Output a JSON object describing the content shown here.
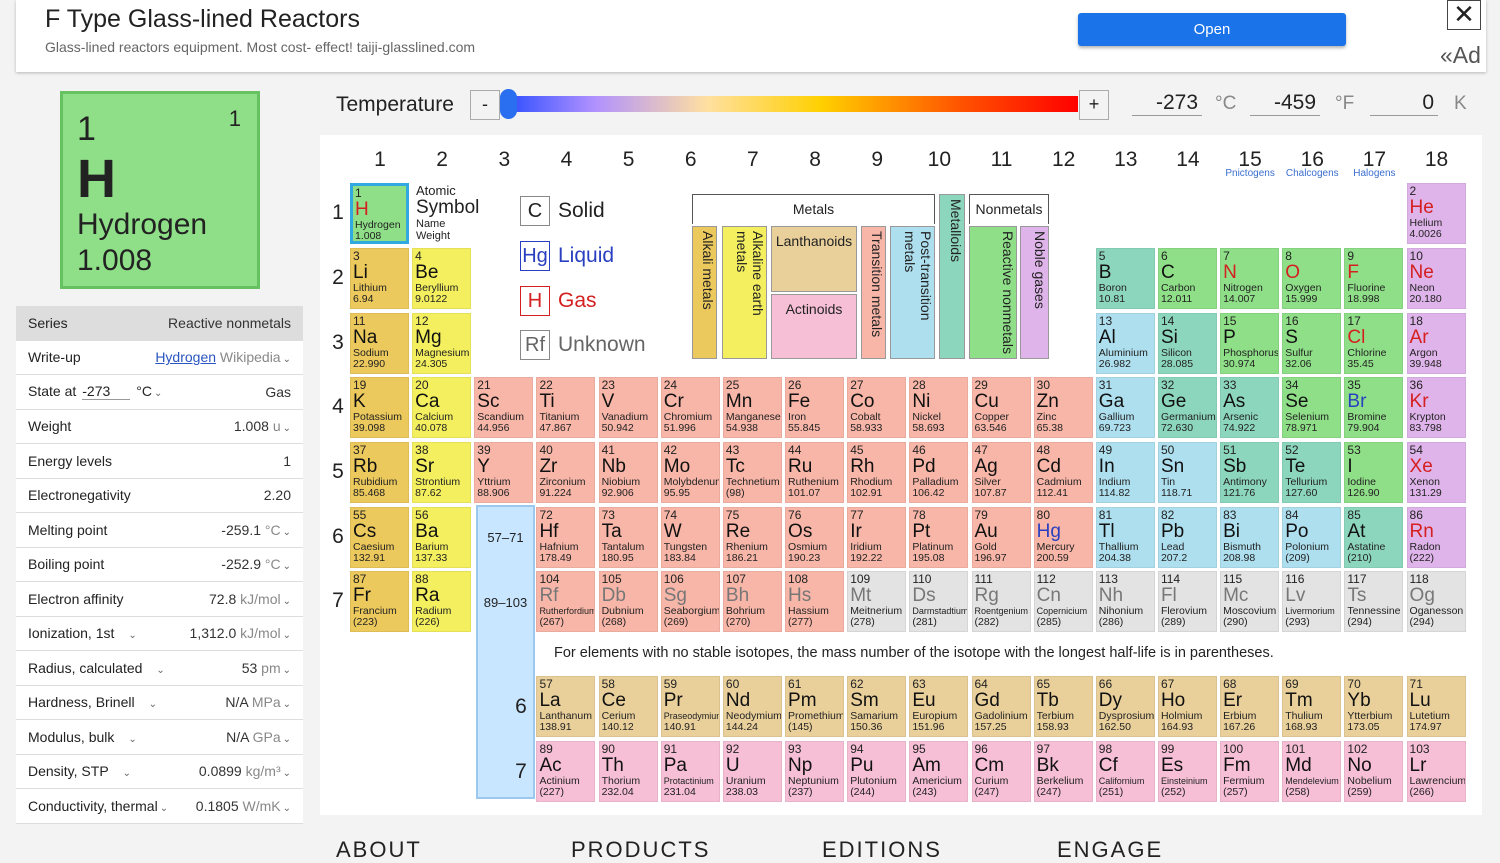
{
  "ad": {
    "title": "F Type Glass-lined Reactors",
    "subtitle": "Glass-lined reactors equipment. Most cost- effect! taiji-glasslined.com",
    "open": "Open",
    "close": "✕",
    "label": "«Ad"
  },
  "tile": {
    "number": "1",
    "valence": "1",
    "symbol": "H",
    "name": "Hydrogen",
    "weight": "1.008"
  },
  "props": {
    "series_label": "Series",
    "series_value": "Reactive nonmetals",
    "writeup_label": "Write-up",
    "writeup_link": "Hydrogen",
    "writeup_source": "Wikipedia",
    "state_label": "State at",
    "state_temp": "-273",
    "state_unit": "°C",
    "state_value": "Gas",
    "weight_label": "Weight",
    "weight_value": "1.008",
    "weight_unit": "u",
    "energy_label": "Energy levels",
    "energy_value": "1",
    "electroneg_label": "Electronegativity",
    "electroneg_value": "2.20",
    "melting_label": "Melting point",
    "melting_value": "-259.1",
    "melting_unit": "°C",
    "boiling_label": "Boiling point",
    "boiling_value": "-252.9",
    "boiling_unit": "°C",
    "affinity_label": "Electron affinity",
    "affinity_value": "72.8",
    "affinity_unit": "kJ/mol",
    "ionization_label": "Ionization, 1st",
    "ionization_value": "1,312.0",
    "ionization_unit": "kJ/mol",
    "radius_label": "Radius, calculated",
    "radius_value": "53",
    "radius_unit": "pm",
    "hardness_label": "Hardness, Brinell",
    "hardness_value": "N/A",
    "hardness_unit": "MPa",
    "modulus_label": "Modulus, bulk",
    "modulus_value": "N/A",
    "modulus_unit": "GPa",
    "density_label": "Density, STP",
    "density_value": "0.0899",
    "density_unit": "kg/m³",
    "conductivity_label": "Conductivity, thermal",
    "conductivity_value": "0.1805",
    "conductivity_unit": "W/mK"
  },
  "temperature": {
    "label": "Temperature",
    "minus": "-",
    "plus": "+",
    "celsius": "-273",
    "celsius_unit": "°C",
    "fahrenheit": "-459",
    "fahrenheit_unit": "°F",
    "kelvin": "0",
    "kelvin_unit": "K",
    "slider_fraction": 0.0
  },
  "groups": [
    "1",
    "2",
    "3",
    "4",
    "5",
    "6",
    "7",
    "8",
    "9",
    "10",
    "11",
    "12",
    "13",
    "14",
    "15",
    "16",
    "17",
    "18"
  ],
  "group_names": {
    "15": "Pnictogens",
    "16": "Chalcogens",
    "17": "Halogens"
  },
  "periods": [
    "1",
    "2",
    "3",
    "4",
    "5",
    "6",
    "7"
  ],
  "lan_periods": [
    "6",
    "7"
  ],
  "legend": {
    "atomic": "Atomic",
    "symbol": "Symbol",
    "name": "Name",
    "weight": "Weight",
    "metals": "Metals",
    "nonmetals": "Nonmetals",
    "alkali": "Alkali metals",
    "alkaline": "Alkaline earth metals",
    "lanthanoids": "Lanthanoids",
    "actinoids": "Actinoids",
    "transition": "Transition metals",
    "posttransition": "Post-transition metals",
    "metalloids": "Metalloids",
    "reactive": "Reactive nonmetals",
    "noble": "Noble gases"
  },
  "states": {
    "solid_sym": "C",
    "solid": "Solid",
    "liquid_sym": "Hg",
    "liquid": "Liquid",
    "gas_sym": "H",
    "gas": "Gas",
    "unknown_sym": "Rf",
    "unknown": "Unknown"
  },
  "lan_ranges": [
    "57–71",
    "89–103"
  ],
  "footnote": "For elements with no stable isotopes, the mass number of the isotope with the longest half-life is in parentheses.",
  "footer": [
    "ABOUT",
    "PRODUCTS",
    "EDITIONS",
    "ENGAGE"
  ],
  "colors": {
    "alkali": "#ecc95c",
    "alkaline": "#f3ef5e",
    "transition": "#f8b6a8",
    "post": "#aedfee",
    "metalloid": "#8dd6be",
    "reactive": "#8fdf88",
    "noble": "#dfb4ea",
    "lanthanoid": "#e9d09b",
    "actinoid": "#f6bfd6",
    "unknown": "#e3e3e3",
    "selected": "#31a8e0"
  },
  "elements": [
    [
      "1",
      "H",
      "Hydrogen",
      "1.008",
      1,
      1,
      "reactive",
      "gas"
    ],
    [
      "2",
      "He",
      "Helium",
      "4.0026",
      18,
      1,
      "noble",
      "gas"
    ],
    [
      "3",
      "Li",
      "Lithium",
      "6.94",
      1,
      2,
      "alkali",
      "solid"
    ],
    [
      "4",
      "Be",
      "Beryllium",
      "9.0122",
      2,
      2,
      "alkaline",
      "solid"
    ],
    [
      "5",
      "B",
      "Boron",
      "10.81",
      13,
      2,
      "metalloid",
      "solid"
    ],
    [
      "6",
      "C",
      "Carbon",
      "12.011",
      14,
      2,
      "reactive",
      "solid"
    ],
    [
      "7",
      "N",
      "Nitrogen",
      "14.007",
      15,
      2,
      "reactive",
      "gas"
    ],
    [
      "8",
      "O",
      "Oxygen",
      "15.999",
      16,
      2,
      "reactive",
      "gas"
    ],
    [
      "9",
      "F",
      "Fluorine",
      "18.998",
      17,
      2,
      "reactive",
      "gas"
    ],
    [
      "10",
      "Ne",
      "Neon",
      "20.180",
      18,
      2,
      "noble",
      "gas"
    ],
    [
      "11",
      "Na",
      "Sodium",
      "22.990",
      1,
      3,
      "alkali",
      "solid"
    ],
    [
      "12",
      "Mg",
      "Magnesium",
      "24.305",
      2,
      3,
      "alkaline",
      "solid"
    ],
    [
      "13",
      "Al",
      "Aluminium",
      "26.982",
      13,
      3,
      "post",
      "solid"
    ],
    [
      "14",
      "Si",
      "Silicon",
      "28.085",
      14,
      3,
      "metalloid",
      "solid"
    ],
    [
      "15",
      "P",
      "Phosphorus",
      "30.974",
      15,
      3,
      "reactive",
      "solid"
    ],
    [
      "16",
      "S",
      "Sulfur",
      "32.06",
      16,
      3,
      "reactive",
      "solid"
    ],
    [
      "17",
      "Cl",
      "Chlorine",
      "35.45",
      17,
      3,
      "reactive",
      "gas"
    ],
    [
      "18",
      "Ar",
      "Argon",
      "39.948",
      18,
      3,
      "noble",
      "gas"
    ],
    [
      "19",
      "K",
      "Potassium",
      "39.098",
      1,
      4,
      "alkali",
      "solid"
    ],
    [
      "20",
      "Ca",
      "Calcium",
      "40.078",
      2,
      4,
      "alkaline",
      "solid"
    ],
    [
      "21",
      "Sc",
      "Scandium",
      "44.956",
      3,
      4,
      "transition",
      "solid"
    ],
    [
      "22",
      "Ti",
      "Titanium",
      "47.867",
      4,
      4,
      "transition",
      "solid"
    ],
    [
      "23",
      "V",
      "Vanadium",
      "50.942",
      5,
      4,
      "transition",
      "solid"
    ],
    [
      "24",
      "Cr",
      "Chromium",
      "51.996",
      6,
      4,
      "transition",
      "solid"
    ],
    [
      "25",
      "Mn",
      "Manganese",
      "54.938",
      7,
      4,
      "transition",
      "solid"
    ],
    [
      "26",
      "Fe",
      "Iron",
      "55.845",
      8,
      4,
      "transition",
      "solid"
    ],
    [
      "27",
      "Co",
      "Cobalt",
      "58.933",
      9,
      4,
      "transition",
      "solid"
    ],
    [
      "28",
      "Ni",
      "Nickel",
      "58.693",
      10,
      4,
      "transition",
      "solid"
    ],
    [
      "29",
      "Cu",
      "Copper",
      "63.546",
      11,
      4,
      "transition",
      "solid"
    ],
    [
      "30",
      "Zn",
      "Zinc",
      "65.38",
      12,
      4,
      "transition",
      "solid"
    ],
    [
      "31",
      "Ga",
      "Gallium",
      "69.723",
      13,
      4,
      "post",
      "solid"
    ],
    [
      "32",
      "Ge",
      "Germanium",
      "72.630",
      14,
      4,
      "metalloid",
      "solid"
    ],
    [
      "33",
      "As",
      "Arsenic",
      "74.922",
      15,
      4,
      "metalloid",
      "solid"
    ],
    [
      "34",
      "Se",
      "Selenium",
      "78.971",
      16,
      4,
      "reactive",
      "solid"
    ],
    [
      "35",
      "Br",
      "Bromine",
      "79.904",
      17,
      4,
      "reactive",
      "liquid"
    ],
    [
      "36",
      "Kr",
      "Krypton",
      "83.798",
      18,
      4,
      "noble",
      "gas"
    ],
    [
      "37",
      "Rb",
      "Rubidium",
      "85.468",
      1,
      5,
      "alkali",
      "solid"
    ],
    [
      "38",
      "Sr",
      "Strontium",
      "87.62",
      2,
      5,
      "alkaline",
      "solid"
    ],
    [
      "39",
      "Y",
      "Yttrium",
      "88.906",
      3,
      5,
      "transition",
      "solid"
    ],
    [
      "40",
      "Zr",
      "Zirconium",
      "91.224",
      4,
      5,
      "transition",
      "solid"
    ],
    [
      "41",
      "Nb",
      "Niobium",
      "92.906",
      5,
      5,
      "transition",
      "solid"
    ],
    [
      "42",
      "Mo",
      "Molybdenum",
      "95.95",
      6,
      5,
      "transition",
      "solid"
    ],
    [
      "43",
      "Tc",
      "Technetium",
      "(98)",
      7,
      5,
      "transition",
      "solid"
    ],
    [
      "44",
      "Ru",
      "Ruthenium",
      "101.07",
      8,
      5,
      "transition",
      "solid"
    ],
    [
      "45",
      "Rh",
      "Rhodium",
      "102.91",
      9,
      5,
      "transition",
      "solid"
    ],
    [
      "46",
      "Pd",
      "Palladium",
      "106.42",
      10,
      5,
      "transition",
      "solid"
    ],
    [
      "47",
      "Ag",
      "Silver",
      "107.87",
      11,
      5,
      "transition",
      "solid"
    ],
    [
      "48",
      "Cd",
      "Cadmium",
      "112.41",
      12,
      5,
      "transition",
      "solid"
    ],
    [
      "49",
      "In",
      "Indium",
      "114.82",
      13,
      5,
      "post",
      "solid"
    ],
    [
      "50",
      "Sn",
      "Tin",
      "118.71",
      14,
      5,
      "post",
      "solid"
    ],
    [
      "51",
      "Sb",
      "Antimony",
      "121.76",
      15,
      5,
      "metalloid",
      "solid"
    ],
    [
      "52",
      "Te",
      "Tellurium",
      "127.60",
      16,
      5,
      "metalloid",
      "solid"
    ],
    [
      "53",
      "I",
      "Iodine",
      "126.90",
      17,
      5,
      "reactive",
      "solid"
    ],
    [
      "54",
      "Xe",
      "Xenon",
      "131.29",
      18,
      5,
      "noble",
      "gas"
    ],
    [
      "55",
      "Cs",
      "Caesium",
      "132.91",
      1,
      6,
      "alkali",
      "solid"
    ],
    [
      "56",
      "Ba",
      "Barium",
      "137.33",
      2,
      6,
      "alkaline",
      "solid"
    ],
    [
      "72",
      "Hf",
      "Hafnium",
      "178.49",
      4,
      6,
      "transition",
      "solid"
    ],
    [
      "73",
      "Ta",
      "Tantalum",
      "180.95",
      5,
      6,
      "transition",
      "solid"
    ],
    [
      "74",
      "W",
      "Tungsten",
      "183.84",
      6,
      6,
      "transition",
      "solid"
    ],
    [
      "75",
      "Re",
      "Rhenium",
      "186.21",
      7,
      6,
      "transition",
      "solid"
    ],
    [
      "76",
      "Os",
      "Osmium",
      "190.23",
      8,
      6,
      "transition",
      "solid"
    ],
    [
      "77",
      "Ir",
      "Iridium",
      "192.22",
      9,
      6,
      "transition",
      "solid"
    ],
    [
      "78",
      "Pt",
      "Platinum",
      "195.08",
      10,
      6,
      "transition",
      "solid"
    ],
    [
      "79",
      "Au",
      "Gold",
      "196.97",
      11,
      6,
      "transition",
      "solid"
    ],
    [
      "80",
      "Hg",
      "Mercury",
      "200.59",
      12,
      6,
      "transition",
      "liquid"
    ],
    [
      "81",
      "Tl",
      "Thallium",
      "204.38",
      13,
      6,
      "post",
      "solid"
    ],
    [
      "82",
      "Pb",
      "Lead",
      "207.2",
      14,
      6,
      "post",
      "solid"
    ],
    [
      "83",
      "Bi",
      "Bismuth",
      "208.98",
      15,
      6,
      "post",
      "solid"
    ],
    [
      "84",
      "Po",
      "Polonium",
      "(209)",
      16,
      6,
      "post",
      "solid"
    ],
    [
      "85",
      "At",
      "Astatine",
      "(210)",
      17,
      6,
      "metalloid",
      "solid"
    ],
    [
      "86",
      "Rn",
      "Radon",
      "(222)",
      18,
      6,
      "noble",
      "gas"
    ],
    [
      "87",
      "Fr",
      "Francium",
      "(223)",
      1,
      7,
      "alkali",
      "solid"
    ],
    [
      "88",
      "Ra",
      "Radium",
      "(226)",
      2,
      7,
      "alkaline",
      "solid"
    ],
    [
      "104",
      "Rf",
      "Rutherfordium",
      "(267)",
      4,
      7,
      "transition",
      "unknown"
    ],
    [
      "105",
      "Db",
      "Dubnium",
      "(268)",
      5,
      7,
      "transition",
      "unknown"
    ],
    [
      "106",
      "Sg",
      "Seaborgium",
      "(269)",
      6,
      7,
      "transition",
      "unknown"
    ],
    [
      "107",
      "Bh",
      "Bohrium",
      "(270)",
      7,
      7,
      "transition",
      "unknown"
    ],
    [
      "108",
      "Hs",
      "Hassium",
      "(277)",
      8,
      7,
      "transition",
      "unknown"
    ],
    [
      "109",
      "Mt",
      "Meitnerium",
      "(278)",
      9,
      7,
      "unknown",
      "unknown"
    ],
    [
      "110",
      "Ds",
      "Darmstadtium",
      "(281)",
      10,
      7,
      "unknown",
      "unknown"
    ],
    [
      "111",
      "Rg",
      "Roentgenium",
      "(282)",
      11,
      7,
      "unknown",
      "unknown"
    ],
    [
      "112",
      "Cn",
      "Copernicium",
      "(285)",
      12,
      7,
      "unknown",
      "unknown"
    ],
    [
      "113",
      "Nh",
      "Nihonium",
      "(286)",
      13,
      7,
      "unknown",
      "unknown"
    ],
    [
      "114",
      "Fl",
      "Flerovium",
      "(289)",
      14,
      7,
      "unknown",
      "unknown"
    ],
    [
      "115",
      "Mc",
      "Moscovium",
      "(290)",
      15,
      7,
      "unknown",
      "unknown"
    ],
    [
      "116",
      "Lv",
      "Livermorium",
      "(293)",
      16,
      7,
      "unknown",
      "unknown"
    ],
    [
      "117",
      "Ts",
      "Tennessine",
      "(294)",
      17,
      7,
      "unknown",
      "unknown"
    ],
    [
      "118",
      "Og",
      "Oganesson",
      "(294)",
      18,
      7,
      "unknown",
      "unknown"
    ],
    [
      "57",
      "La",
      "Lanthanum",
      "138.91",
      4,
      9,
      "lanthanoid",
      "solid"
    ],
    [
      "58",
      "Ce",
      "Cerium",
      "140.12",
      5,
      9,
      "lanthanoid",
      "solid"
    ],
    [
      "59",
      "Pr",
      "Praseodymium",
      "140.91",
      6,
      9,
      "lanthanoid",
      "solid"
    ],
    [
      "60",
      "Nd",
      "Neodymium",
      "144.24",
      7,
      9,
      "lanthanoid",
      "solid"
    ],
    [
      "61",
      "Pm",
      "Promethium",
      "(145)",
      8,
      9,
      "lanthanoid",
      "solid"
    ],
    [
      "62",
      "Sm",
      "Samarium",
      "150.36",
      9,
      9,
      "lanthanoid",
      "solid"
    ],
    [
      "63",
      "Eu",
      "Europium",
      "151.96",
      10,
      9,
      "lanthanoid",
      "solid"
    ],
    [
      "64",
      "Gd",
      "Gadolinium",
      "157.25",
      11,
      9,
      "lanthanoid",
      "solid"
    ],
    [
      "65",
      "Tb",
      "Terbium",
      "158.93",
      12,
      9,
      "lanthanoid",
      "solid"
    ],
    [
      "66",
      "Dy",
      "Dysprosium",
      "162.50",
      13,
      9,
      "lanthanoid",
      "solid"
    ],
    [
      "67",
      "Ho",
      "Holmium",
      "164.93",
      14,
      9,
      "lanthanoid",
      "solid"
    ],
    [
      "68",
      "Er",
      "Erbium",
      "167.26",
      15,
      9,
      "lanthanoid",
      "solid"
    ],
    [
      "69",
      "Tm",
      "Thulium",
      "168.93",
      16,
      9,
      "lanthanoid",
      "solid"
    ],
    [
      "70",
      "Yb",
      "Ytterbium",
      "173.05",
      17,
      9,
      "lanthanoid",
      "solid"
    ],
    [
      "71",
      "Lu",
      "Lutetium",
      "174.97",
      18,
      9,
      "lanthanoid",
      "solid"
    ],
    [
      "89",
      "Ac",
      "Actinium",
      "(227)",
      4,
      10,
      "actinoid",
      "solid"
    ],
    [
      "90",
      "Th",
      "Thorium",
      "232.04",
      5,
      10,
      "actinoid",
      "solid"
    ],
    [
      "91",
      "Pa",
      "Protactinium",
      "231.04",
      6,
      10,
      "actinoid",
      "solid"
    ],
    [
      "92",
      "U",
      "Uranium",
      "238.03",
      7,
      10,
      "actinoid",
      "solid"
    ],
    [
      "93",
      "Np",
      "Neptunium",
      "(237)",
      8,
      10,
      "actinoid",
      "solid"
    ],
    [
      "94",
      "Pu",
      "Plutonium",
      "(244)",
      9,
      10,
      "actinoid",
      "solid"
    ],
    [
      "95",
      "Am",
      "Americium",
      "(243)",
      10,
      10,
      "actinoid",
      "solid"
    ],
    [
      "96",
      "Cm",
      "Curium",
      "(247)",
      11,
      10,
      "actinoid",
      "solid"
    ],
    [
      "97",
      "Bk",
      "Berkelium",
      "(247)",
      12,
      10,
      "actinoid",
      "solid"
    ],
    [
      "98",
      "Cf",
      "Californium",
      "(251)",
      13,
      10,
      "actinoid",
      "solid"
    ],
    [
      "99",
      "Es",
      "Einsteinium",
      "(252)",
      14,
      10,
      "actinoid",
      "solid"
    ],
    [
      "100",
      "Fm",
      "Fermium",
      "(257)",
      15,
      10,
      "actinoid",
      "solid"
    ],
    [
      "101",
      "Md",
      "Mendelevium",
      "(258)",
      16,
      10,
      "actinoid",
      "solid"
    ],
    [
      "102",
      "No",
      "Nobelium",
      "(259)",
      17,
      10,
      "actinoid",
      "solid"
    ],
    [
      "103",
      "Lr",
      "Lawrencium",
      "(266)",
      18,
      10,
      "actinoid",
      "solid"
    ]
  ]
}
